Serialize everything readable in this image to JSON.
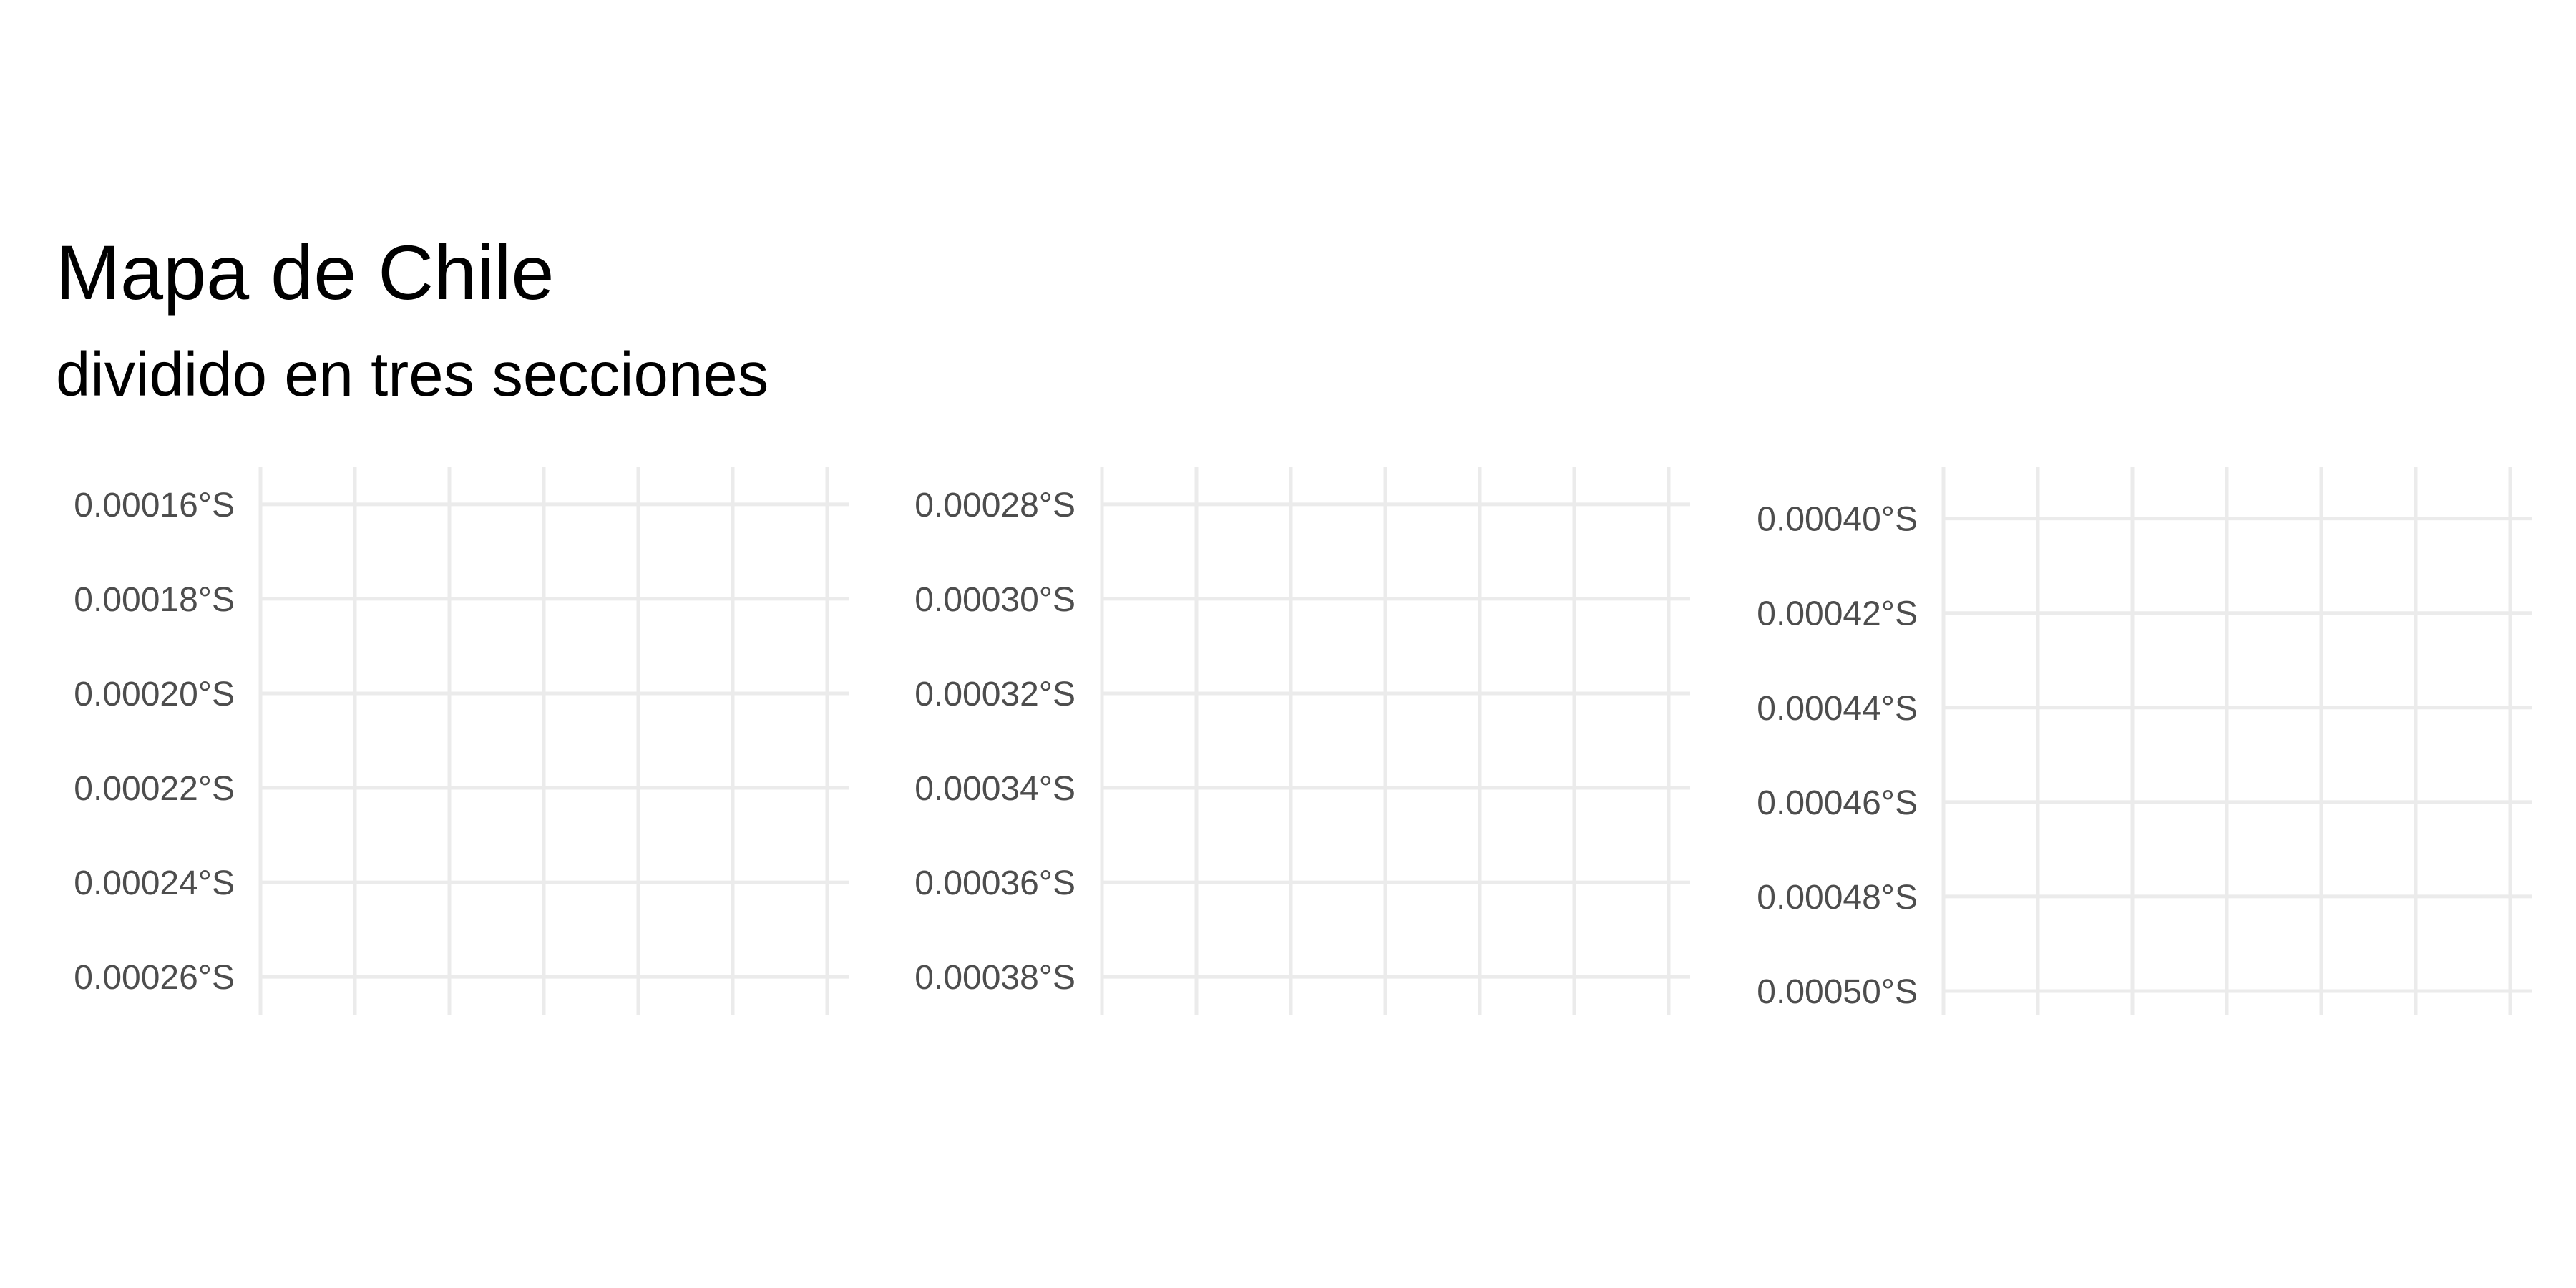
{
  "chart_data": {
    "type": "map",
    "title": "Mapa de Chile",
    "subtitle": "dividido en tres secciones",
    "grid": true,
    "panels": [
      {
        "y_tick_labels": [
          "0.00016°S",
          "0.00018°S",
          "0.00020°S",
          "0.00022°S",
          "0.00024°S",
          "0.00026°S"
        ],
        "y_values": [
          0.00016,
          0.00018,
          0.0002,
          0.00022,
          0.00024,
          0.00026
        ],
        "ylim": [
          0.000152,
          0.000268
        ],
        "x_gridlines": 7,
        "x_tick_labels": []
      },
      {
        "y_tick_labels": [
          "0.00028°S",
          "0.00030°S",
          "0.00032°S",
          "0.00034°S",
          "0.00036°S",
          "0.00038°S"
        ],
        "y_values": [
          0.00028,
          0.0003,
          0.00032,
          0.00034,
          0.00036,
          0.00038
        ],
        "ylim": [
          0.000272,
          0.000388
        ],
        "x_gridlines": 7,
        "x_tick_labels": []
      },
      {
        "y_tick_labels": [
          "0.00040°S",
          "0.00042°S",
          "0.00044°S",
          "0.00046°S",
          "0.00048°S",
          "0.00050°S"
        ],
        "y_values": [
          0.0004,
          0.00042,
          0.00044,
          0.00046,
          0.00048,
          0.0005
        ],
        "ylim": [
          0.000389,
          0.000505
        ],
        "x_gridlines": 7,
        "x_tick_labels": []
      }
    ]
  },
  "colors": {
    "background": "#ffffff",
    "grid": "#ebebeb",
    "tick_text": "#4d4d4d",
    "title_text": "#000000"
  }
}
